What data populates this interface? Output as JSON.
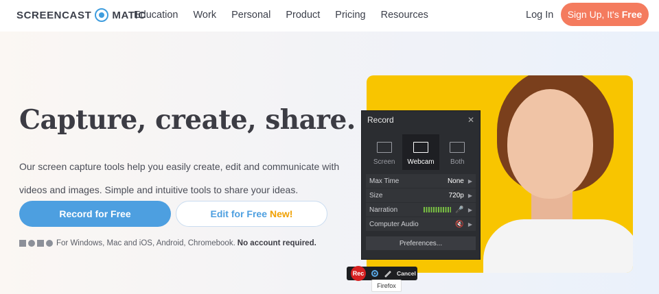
{
  "brand": {
    "part1": "SCREENCAST",
    "part2": "MATIC",
    "accent": "#3f9dde"
  },
  "nav": {
    "items": [
      "Education",
      "Work",
      "Personal",
      "Product",
      "Pricing",
      "Resources"
    ],
    "login": "Log In",
    "signup_text": "Sign Up, It's",
    "signup_bold": "Free",
    "signup_color": "#f47b5e"
  },
  "hero": {
    "headline": "Capture, create, share.",
    "description": "Our screen capture tools help you easily create, edit and communicate with videos and images. Simple and intuitive tools to share your ideas.",
    "record_button": "Record for Free",
    "edit_button": "Edit for Free",
    "edit_badge": "New!",
    "platforms_text": "For Windows, Mac and iOS, Android, Chromebook.",
    "platforms_bold": "No account required."
  },
  "recorder": {
    "title": "Record",
    "close": "✕",
    "modes": [
      {
        "label": "Screen",
        "icon": "monitor-icon"
      },
      {
        "label": "Webcam",
        "icon": "webcam-icon"
      },
      {
        "label": "Both",
        "icon": "screen-webcam-icon"
      }
    ],
    "active_mode": "Webcam",
    "settings": {
      "max_time_label": "Max Time",
      "max_time_value": "None",
      "size_label": "Size",
      "size_value": "720p",
      "narration_label": "Narration",
      "computer_audio_label": "Computer Audio"
    },
    "preferences": "Preferences..."
  },
  "toolbar": {
    "rec": "Rec",
    "cancel": "Cancel",
    "tooltip": "Firefox"
  }
}
